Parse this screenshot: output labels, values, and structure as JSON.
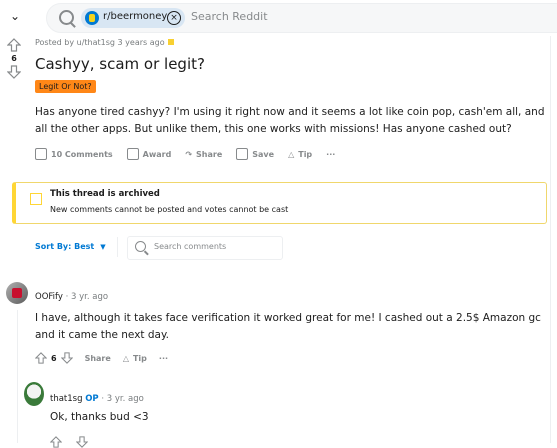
{
  "topbar": {
    "subreddit_chip": "r/beermoney",
    "search_placeholder": "Search Reddit"
  },
  "post": {
    "vote_count": "6",
    "meta": "Posted by u/that1sg 3 years ago",
    "title": "Cashyy, scam or legit?",
    "flair": "Legit Or Not?",
    "body": "Has anyone tired cashyy? I'm using it right now and it seems a lot like coin pop, cash'em all, and all the other apps. But unlike them, this one works with missions! Has anyone cashed out?",
    "actions": {
      "comments": "10 Comments",
      "award": "Award",
      "share": "Share",
      "save": "Save",
      "tip": "Tip",
      "more": "···"
    }
  },
  "archived": {
    "title": "This thread is archived",
    "description": "New comments cannot be posted and votes cannot be cast"
  },
  "comments_bar": {
    "sort_label": "Sort By: Best",
    "search_placeholder": "Search comments"
  },
  "comments": [
    {
      "author": "OOFify",
      "time": "· 3 yr. ago",
      "body": "I have, although it takes face verification it worked great for me! I cashed out a 2.5$ Amazon gc and it came the next day.",
      "votes": "6",
      "share": "Share",
      "tip": "Tip",
      "more": "···"
    },
    {
      "author": "that1sg",
      "op_badge": "OP",
      "time": "· 3 yr. ago",
      "body": "Ok, thanks bud <3"
    }
  ],
  "colors": {
    "accent": "#0079d3",
    "flair_bg": "#ff8717",
    "archived_border": "#ffd635",
    "muted": "#878a8c"
  }
}
